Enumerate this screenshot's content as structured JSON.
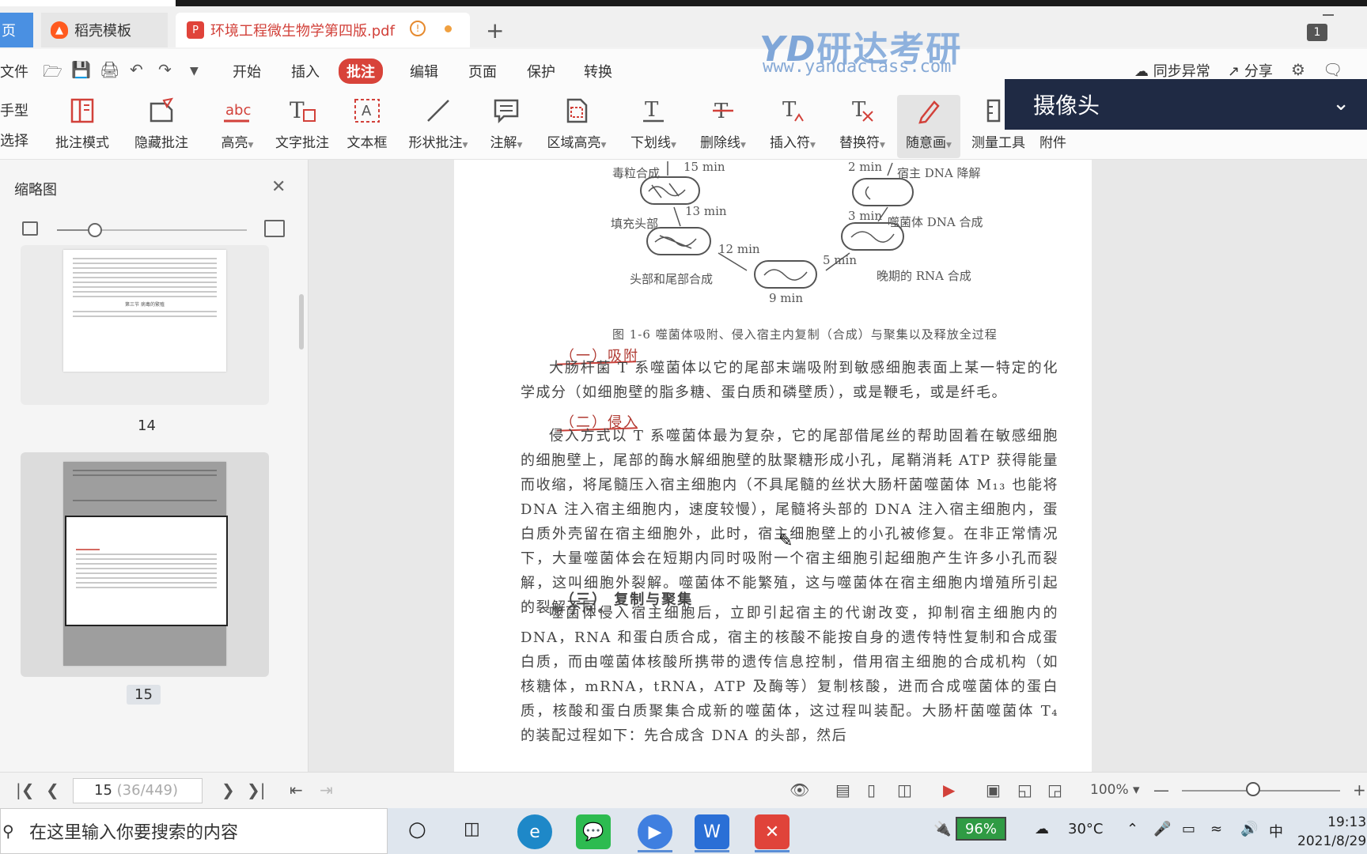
{
  "tabs": {
    "home_label": "页",
    "daoke_label": "稻壳模板",
    "pdf_label": "环境工程微生物学第四版.pdf",
    "warn_mark": "!",
    "new_tab": "+"
  },
  "window": {
    "badge": "1"
  },
  "watermark": {
    "logo_letters": "YD",
    "logo_cn": "研达考研",
    "url": "www.yandaclass.com"
  },
  "menu": {
    "file": "文件",
    "items": [
      "开始",
      "插入",
      "批注",
      "编辑",
      "页面",
      "保护",
      "转换"
    ],
    "active": "批注",
    "sync": "同步异常",
    "share": "分享"
  },
  "ribbon": {
    "side_top": "手型",
    "side_bottom": "选择",
    "buttons": [
      {
        "label": "批注模式"
      },
      {
        "label": "隐藏批注"
      },
      {
        "label": "高亮",
        "dropdown": true
      },
      {
        "label": "文字批注"
      },
      {
        "label": "文本框"
      },
      {
        "label": "形状批注",
        "dropdown": true
      },
      {
        "label": "注解",
        "dropdown": true
      },
      {
        "label": "区域高亮",
        "dropdown": true
      },
      {
        "label": "下划线",
        "dropdown": true
      },
      {
        "label": "删除线",
        "dropdown": true
      },
      {
        "label": "插入符",
        "dropdown": true
      },
      {
        "label": "替换符",
        "dropdown": true
      },
      {
        "label": "随意画",
        "dropdown": true,
        "active": true
      },
      {
        "label": "测量工具"
      },
      {
        "label": "附件"
      }
    ],
    "highlight_icon_text": "abc"
  },
  "camera": {
    "title": "摄像头"
  },
  "sidebar": {
    "title": "缩略图",
    "thumb_size_fraction": 0.2,
    "pages": [
      {
        "num": "14",
        "heading": "第三节  病毒的繁殖"
      },
      {
        "num": "15",
        "active": true
      }
    ]
  },
  "document": {
    "figure": {
      "labels": {
        "t15": "15 min",
        "toxin": "毒粒合成",
        "t13": "13 min",
        "fill_head": "填充头部",
        "t12": "12 min",
        "head_tail": "头部和尾部合成",
        "t9": "9 min",
        "t2": "2 min",
        "host_dna": "宿主 DNA 降解",
        "t3": "3 min",
        "phage_dna": "噬菌体 DNA 合成",
        "t5": "5 min",
        "late_rna": "晚期的 RNA 合成"
      },
      "caption": "图 1-6   噬菌体吸附、侵入宿主内复制（合成）与聚集以及释放全过程"
    },
    "h1": "（一）吸附",
    "p1": "大肠杆菌 T 系噬菌体以它的尾部末端吸附到敏感细胞表面上某一特定的化学成分（如细胞壁的脂多糖、蛋白质和磷壁质），或是鞭毛，或是纤毛。",
    "h2": "（二）侵入",
    "p2": "侵入方式以 T 系噬菌体最为复杂，它的尾部借尾丝的帮助固着在敏感细胞的细胞壁上，尾部的酶水解细胞壁的肽聚糖形成小孔，尾鞘消耗 ATP 获得能量而收缩，将尾髓压入宿主细胞内（不具尾髓的丝状大肠杆菌噬菌体 M₁₃ 也能将 DNA 注入宿主细胞内，速度较慢），尾髓将头部的 DNA 注入宿主细胞内，蛋白质外壳留在宿主细胞外，此时，宿主细胞壁上的小孔被修复。在非正常情况下，大量噬菌体会在短期内同时吸附一个宿主细胞引起细胞产生许多小孔而裂解，这叫细胞外裂解。噬菌体不能繁殖，这与噬菌体在宿主细胞内增殖所引起的裂解不同。",
    "h3": "（三）  复制与聚集",
    "p3": "噬菌体侵入宿主细胞后，立即引起宿主的代谢改变，抑制宿主细胞内的 DNA，RNA 和蛋白质合成，宿主的核酸不能按自身的遗传特性复制和合成蛋白质，而由噬菌体核酸所携带的遗传信息控制，借用宿主细胞的合成机构（如核糖体，mRNA，tRNA，ATP 及酶等）复制核酸，进而合成噬菌体的蛋白质，核酸和蛋白质聚集合成新的噬菌体，这过程叫装配。大肠杆菌噬菌体 T₄ 的装配过程如下：先合成含 DNA 的头部，然后"
  },
  "statusbar": {
    "page_current": "15",
    "page_total": "(36/449)",
    "zoom": "100%",
    "zoom_fraction": 0.45
  },
  "taskbar": {
    "search_placeholder": "在这里输入你要搜索的内容",
    "battery": "96%",
    "temperature": "30°C",
    "ime": "中",
    "time": "19:13",
    "date": "2021/8/29"
  }
}
